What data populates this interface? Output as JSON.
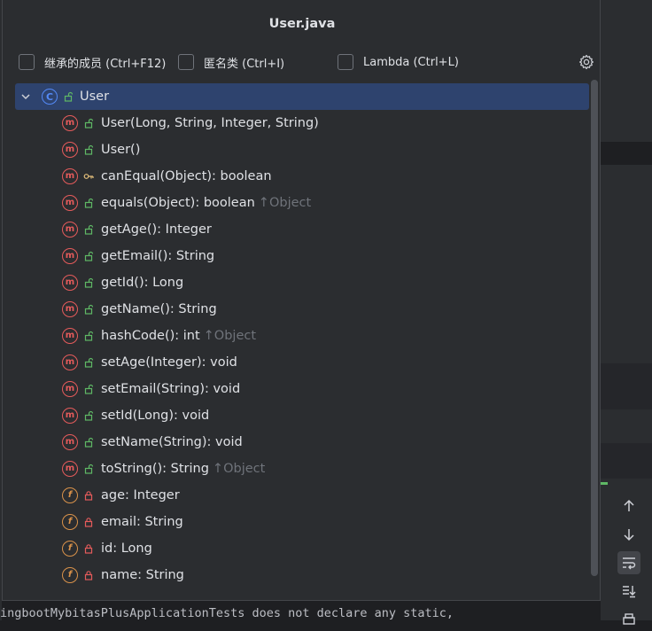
{
  "popup": {
    "title": "User.java",
    "filters": [
      {
        "label": "继承的成员 (Ctrl+F12)",
        "checked": false
      },
      {
        "label": "匿名类 (Ctrl+I)",
        "checked": false
      },
      {
        "label": "Lambda (Ctrl+L)",
        "checked": false
      }
    ],
    "settings_icon": "gear-icon"
  },
  "tree": {
    "root": {
      "label": "User",
      "kind": "class",
      "visibility": "public"
    },
    "members": [
      {
        "label": "User(Long, String, Integer, String)",
        "kind": "method",
        "visibility": "public",
        "inherited": ""
      },
      {
        "label": "User()",
        "kind": "method",
        "visibility": "public",
        "inherited": ""
      },
      {
        "label": "canEqual(Object): boolean",
        "kind": "method",
        "visibility": "protected",
        "inherited": ""
      },
      {
        "label": "equals(Object): boolean",
        "kind": "method",
        "visibility": "public",
        "inherited": "↑Object"
      },
      {
        "label": "getAge(): Integer",
        "kind": "method",
        "visibility": "public",
        "inherited": ""
      },
      {
        "label": "getEmail(): String",
        "kind": "method",
        "visibility": "public",
        "inherited": ""
      },
      {
        "label": "getId(): Long",
        "kind": "method",
        "visibility": "public",
        "inherited": ""
      },
      {
        "label": "getName(): String",
        "kind": "method",
        "visibility": "public",
        "inherited": ""
      },
      {
        "label": "hashCode(): int",
        "kind": "method",
        "visibility": "public",
        "inherited": "↑Object"
      },
      {
        "label": "setAge(Integer): void",
        "kind": "method",
        "visibility": "public",
        "inherited": ""
      },
      {
        "label": "setEmail(String): void",
        "kind": "method",
        "visibility": "public",
        "inherited": ""
      },
      {
        "label": "setId(Long): void",
        "kind": "method",
        "visibility": "public",
        "inherited": ""
      },
      {
        "label": "setName(String): void",
        "kind": "method",
        "visibility": "public",
        "inherited": ""
      },
      {
        "label": "toString(): String",
        "kind": "method",
        "visibility": "public",
        "inherited": "↑Object"
      },
      {
        "label": "age: Integer",
        "kind": "field",
        "visibility": "private",
        "inherited": ""
      },
      {
        "label": "email: String",
        "kind": "field",
        "visibility": "private",
        "inherited": ""
      },
      {
        "label": "id: Long",
        "kind": "field",
        "visibility": "private",
        "inherited": ""
      },
      {
        "label": "name: String",
        "kind": "field",
        "visibility": "private",
        "inherited": ""
      }
    ]
  },
  "background": {
    "console_line": "ingbootMybitasPlusApplicationTests does not declare any static,"
  },
  "colors": {
    "selection": "#2e436e",
    "method_icon": "#e55b5b",
    "field_icon": "#d9924a",
    "class_icon": "#548af7",
    "public_lock": "#5fb865",
    "private_lock": "#e55b5b",
    "protected_key": "#e5c07b"
  }
}
